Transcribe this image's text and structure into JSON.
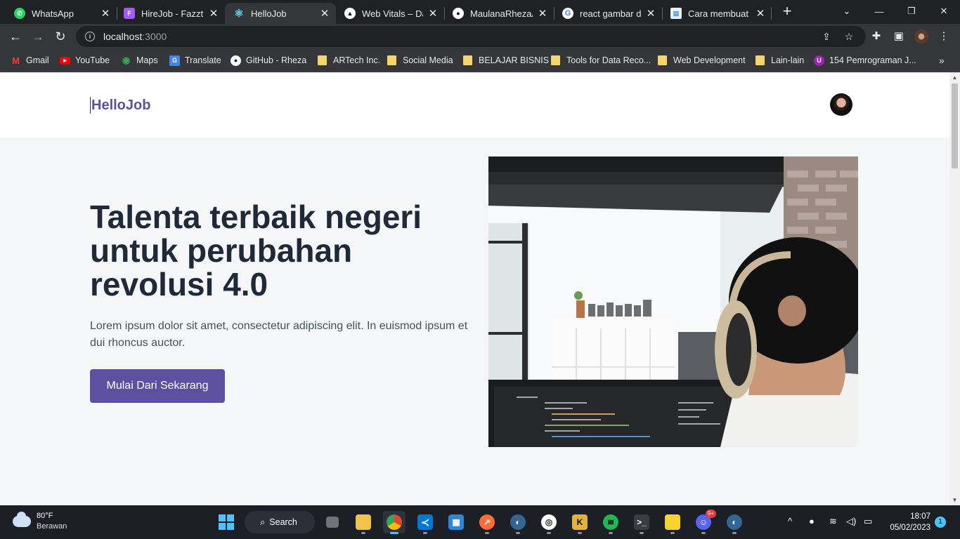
{
  "browser": {
    "tabs": [
      {
        "title": "WhatsApp",
        "icon": "whatsapp-icon",
        "color": "#25d366",
        "active": false
      },
      {
        "title": "HireJob - Fazztrac",
        "icon": "figma-icon",
        "color": "#f24e1e",
        "active": false
      },
      {
        "title": "HelloJob",
        "icon": "react-icon",
        "color": "#61dafb",
        "active": true
      },
      {
        "title": "Web Vitals – Dasl",
        "icon": "vercel-icon",
        "color": "#ffffff",
        "active": false
      },
      {
        "title": "MaulanaRhezaAr",
        "icon": "github-icon",
        "color": "#ffffff",
        "active": false
      },
      {
        "title": "react gambar dik",
        "icon": "google-icon",
        "color": "#4285f4",
        "active": false
      },
      {
        "title": "Cara membuat lir",
        "icon": "page-icon",
        "color": "#4a90d9",
        "active": false
      }
    ],
    "new_tab_label": "+",
    "url_host": "localhost",
    "url_port": ":3000"
  },
  "bookmarks": [
    {
      "label": "Gmail",
      "icon": "gmail-icon",
      "color": "#ea4335"
    },
    {
      "label": "YouTube",
      "icon": "youtube-icon",
      "color": "#ff0000"
    },
    {
      "label": "Maps",
      "icon": "maps-icon",
      "color": "#34a853"
    },
    {
      "label": "Translate",
      "icon": "translate-icon",
      "color": "#4285f4"
    },
    {
      "label": "GitHub - Rheza",
      "icon": "github-icon",
      "color": "#ffffff"
    },
    {
      "label": "ARTech Inc.",
      "icon": "folder-icon",
      "color": "#f5d46b"
    },
    {
      "label": "Social Media",
      "icon": "folder-icon",
      "color": "#f5d46b"
    },
    {
      "label": "BELAJAR BISNIS",
      "icon": "folder-icon",
      "color": "#f5d46b"
    },
    {
      "label": "Tools for Data Reco...",
      "icon": "folder-icon",
      "color": "#f5d46b"
    },
    {
      "label": "Web Development",
      "icon": "folder-icon",
      "color": "#f5d46b"
    },
    {
      "label": "Lain-lain",
      "icon": "folder-icon",
      "color": "#f5d46b"
    },
    {
      "label": "154 Pemrograman J...",
      "icon": "course-icon",
      "color": "#9c27b0"
    }
  ],
  "page": {
    "brand": "HelloJob",
    "brand_color": "#5e50a1",
    "hero_title": "Talenta terbaik negeri untuk perubahan revolusi 4.0",
    "hero_description": "Lorem ipsum dolor sit amet, consectetur adipiscing elit. In euismod ipsum et dui rhoncus auctor.",
    "cta_label": "Mulai Dari Sekarang",
    "hero_image": "man-with-headphones-coding-photo"
  },
  "taskbar": {
    "weather_temp": "80°F",
    "weather_condition": "Berawan",
    "search_label": "Search",
    "time": "18:07",
    "date": "05/02/2023",
    "notification_count": "1",
    "discord_badge": "9+"
  }
}
